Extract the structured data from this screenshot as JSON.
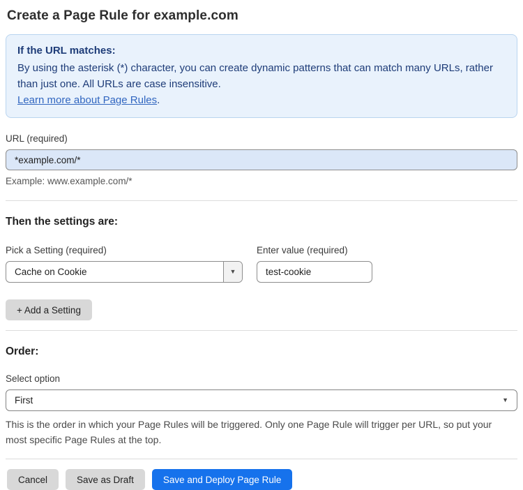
{
  "page": {
    "title": "Create a Page Rule for example.com"
  },
  "info_box": {
    "heading": "If the URL matches:",
    "body": "By using the asterisk (*) character, you can create dynamic patterns that can match many URLs, rather than just one. All URLs are case insensitive.",
    "link_label": "Learn more about Page Rules",
    "link_suffix": "."
  },
  "url_field": {
    "label": "URL (required)",
    "value": "*example.com/*",
    "helper": "Example: www.example.com/*"
  },
  "settings_section": {
    "heading": "Then the settings are:",
    "setting_label": "Pick a Setting (required)",
    "setting_value": "Cache on Cookie",
    "value_label": "Enter value (required)",
    "value_value": "test-cookie",
    "add_setting_label": "+ Add a Setting",
    "dropdown_arrow": "▼"
  },
  "order_section": {
    "heading": "Order:",
    "select_label": "Select option",
    "select_value": "First",
    "dropdown_arrow": "▼",
    "helper": "This is the order in which your Page Rules will be triggered. Only one Page Rule will trigger per URL, so put your most specific Page Rules at the top."
  },
  "actions": {
    "cancel_label": "Cancel",
    "save_draft_label": "Save as Draft",
    "deploy_label": "Save and Deploy Page Rule"
  },
  "colors": {
    "primary_blue": "#1672ec",
    "info_background": "#e9f2fc",
    "info_border": "#b9d4ef",
    "info_text": "#1e3c78",
    "link_blue": "#3166c0",
    "url_input_background": "#dbe7f8",
    "button_gray": "#d8d8d8"
  }
}
